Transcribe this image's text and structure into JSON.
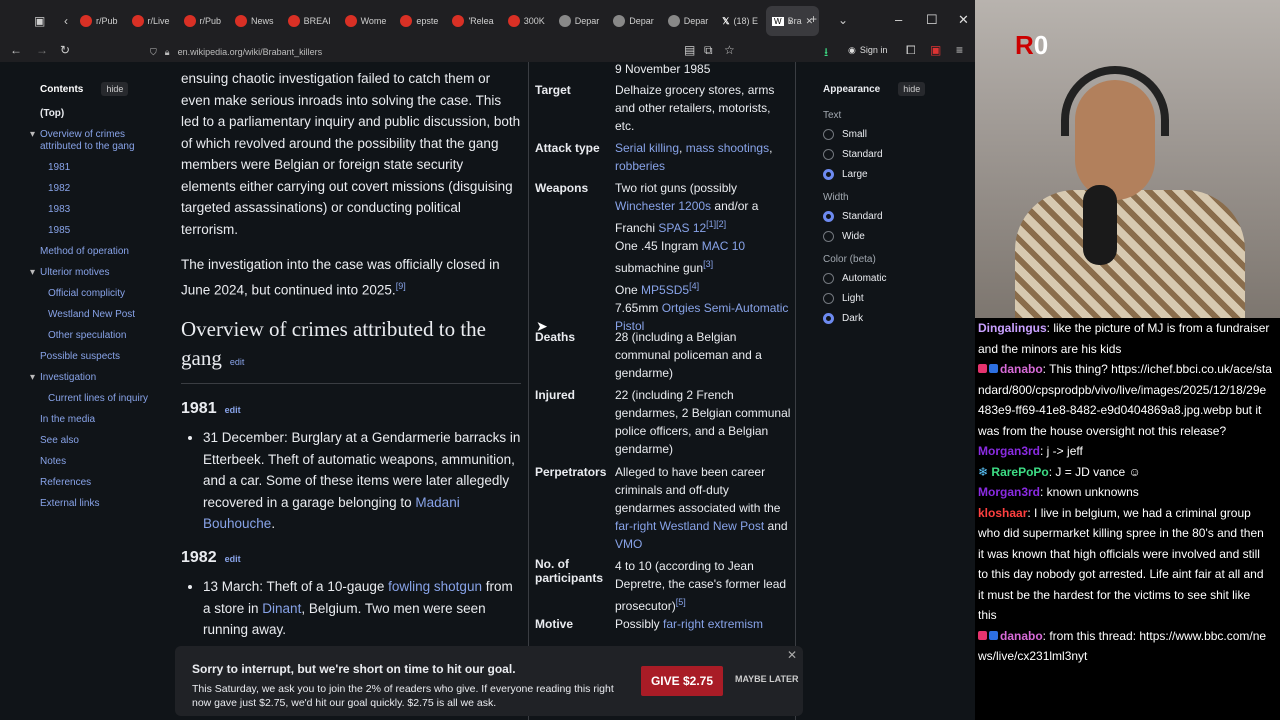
{
  "browser": {
    "tabs": [
      {
        "label": "r/Pub"
      },
      {
        "label": "r/Live"
      },
      {
        "label": "r/Pub"
      },
      {
        "label": "News"
      },
      {
        "label": "BREAI"
      },
      {
        "label": "Wome"
      },
      {
        "label": "epste"
      },
      {
        "label": "'Relea"
      },
      {
        "label": "300K"
      },
      {
        "label": "Depar"
      },
      {
        "label": "Depar"
      },
      {
        "label": "Depar"
      },
      {
        "label": "(18) E"
      },
      {
        "label": "Bra"
      }
    ],
    "url": "en.wikipedia.org/wiki/Brabant_killers",
    "sign_in": "Sign in"
  },
  "toc": {
    "title": "Contents",
    "hide": "hide",
    "items": [
      {
        "label": "(Top)"
      },
      {
        "label": "Overview of crimes attributed to the gang"
      },
      {
        "label": "1981"
      },
      {
        "label": "1982"
      },
      {
        "label": "1983"
      },
      {
        "label": "1985"
      },
      {
        "label": "Method of operation"
      },
      {
        "label": "Ulterior motives"
      },
      {
        "label": "Official complicity"
      },
      {
        "label": "Westland New Post"
      },
      {
        "label": "Other speculation"
      },
      {
        "label": "Possible suspects"
      },
      {
        "label": "Investigation"
      },
      {
        "label": "Current lines of inquiry"
      },
      {
        "label": "In the media"
      },
      {
        "label": "See also"
      },
      {
        "label": "Notes"
      },
      {
        "label": "References"
      },
      {
        "label": "External links"
      }
    ]
  },
  "article": {
    "p1": "ensuing chaotic investigation failed to catch them or even make serious inroads into solving the case. This led to a parliamentary inquiry and public discussion, both of which revolved around the possibility that the gang members were Belgian or foreign state security elements either carrying out covert missions (disguising targeted assassinations) or conducting political terrorism.",
    "p2": "The investigation into the case was officially closed in June 2024, but continued into 2025.",
    "p2_ref": "[9]",
    "h2": "Overview of crimes attributed to the gang",
    "edit": "edit",
    "h3_1981": "1981",
    "item_1981": "31 December: Burglary at a Gendarmerie barracks in Etterbeek. Theft of automatic weapons, ammunition, and a car. Some of these items were later allegedly recovered in a garage belonging to",
    "item_1981_link": "Madani Bouhouche",
    "item_1981_end": ".",
    "h3_1982": "1982",
    "item_1982_a": "13 March: Theft of a 10-gauge",
    "item_1982_link1": "fowling shotgun",
    "item_1982_b": "from a store in",
    "item_1982_link2": "Dinant",
    "item_1982_c": ", Belgium. Two men were seen running away."
  },
  "infobox": {
    "date_tail": "9 November 1985",
    "target_k": "Target",
    "target_v": "Delhaize grocery stores, arms and other retailers, motorists, etc.",
    "attack_k": "Attack type",
    "attack_v1": "Serial killing",
    "attack_v2": "mass shootings",
    "attack_v3": "robberies",
    "weapons_k": "Weapons",
    "weapons_a": "Two riot guns (possibly",
    "weapons_b": "Winchester 1200s",
    "weapons_c": "and/or a Franchi",
    "weapons_d": "SPAS 12",
    "weapons_d_ref": "[1][2]",
    "weapons_e": "One .45 Ingram",
    "weapons_f": "MAC 10",
    "weapons_g": "submachine gun",
    "weapons_g_ref": "[3]",
    "weapons_h": "One",
    "weapons_i": "MP5SD5",
    "weapons_i_ref": "[4]",
    "weapons_j": "7.65mm",
    "weapons_k2": "Ortgies Semi-Automatic Pistol",
    "deaths_k": "Deaths",
    "deaths_v": "28 (including a Belgian communal policeman and a gendarme)",
    "injured_k": "Injured",
    "injured_v": "22 (including 2 French gendarmes, 2 Belgian communal police officers, and a Belgian gendarme)",
    "perp_k": "Perpetrators",
    "perp_v": "Alleged to have been career criminals and off-duty gendarmes associated with the",
    "perp_link1": "far-right Westland New Post",
    "perp_and": "and",
    "perp_link2": "VMO",
    "part_k": "No. of participants",
    "part_v": "4 to 10 (according to Jean Depretre, the case's former lead prosecutor)",
    "part_ref": "[5]",
    "motive_k": "Motive",
    "motive_a": "Possibly",
    "motive_link": "far-right extremism"
  },
  "appearance": {
    "title": "Appearance",
    "hide": "hide",
    "text_label": "Text",
    "text_opts": [
      "Small",
      "Standard",
      "Large"
    ],
    "width_label": "Width",
    "width_opts": [
      "Standard",
      "Wide"
    ],
    "color_label": "Color (beta)",
    "color_opts": [
      "Automatic",
      "Light",
      "Dark"
    ]
  },
  "banner": {
    "heading": "Sorry to interrupt, but we're short on time to hit our goal.",
    "body": "This Saturday, we ask you to join the 2% of readers who give. If everyone reading this right now gave just $2.75, we'd hit our goal quickly. $2.75 is all we ask.",
    "give": "GIVE $2.75",
    "later": "MAYBE LATER"
  },
  "stream": {
    "logo_num": "0",
    "chat": [
      {
        "user": "Dingalingus",
        "text": ": like the picture of MJ is from a fundraiser and the minors are his kids",
        "color": "#c9a0ff"
      },
      {
        "user": "danabo",
        "text": ": This thing? https://ichef.bbci.co.uk/ace/standard/800/cpsprodpb/vivo/live/images/2025/12/18/29e483e9-ff69-41e8-8482-e9d0404869a8.jpg.webp but it was from the house oversight not this release?",
        "color": "#d86bd8"
      },
      {
        "user": "Morgan3rd",
        "text": ": j -> jeff",
        "color": "#8a2be2"
      },
      {
        "user": "RarePoPo",
        "text": ": J = JD vance",
        "color": "#3ddc84"
      },
      {
        "user": "Morgan3rd",
        "text": ": known unknowns",
        "color": "#8a2be2"
      },
      {
        "user": "kloshaar",
        "text": ": I live in belgium, we had a criminal group who did supermarket killing spree in the 80's and then it was known that high officials were involved and still to this day nobody got arrested. Life aint fair at all and it must be the hardest for the victims to see shit like this",
        "color": "#ff4040"
      },
      {
        "user": "danabo",
        "text": ": from this thread: https://www.bbc.com/news/live/cx231lml3nyt",
        "color": "#d86bd8"
      }
    ]
  }
}
